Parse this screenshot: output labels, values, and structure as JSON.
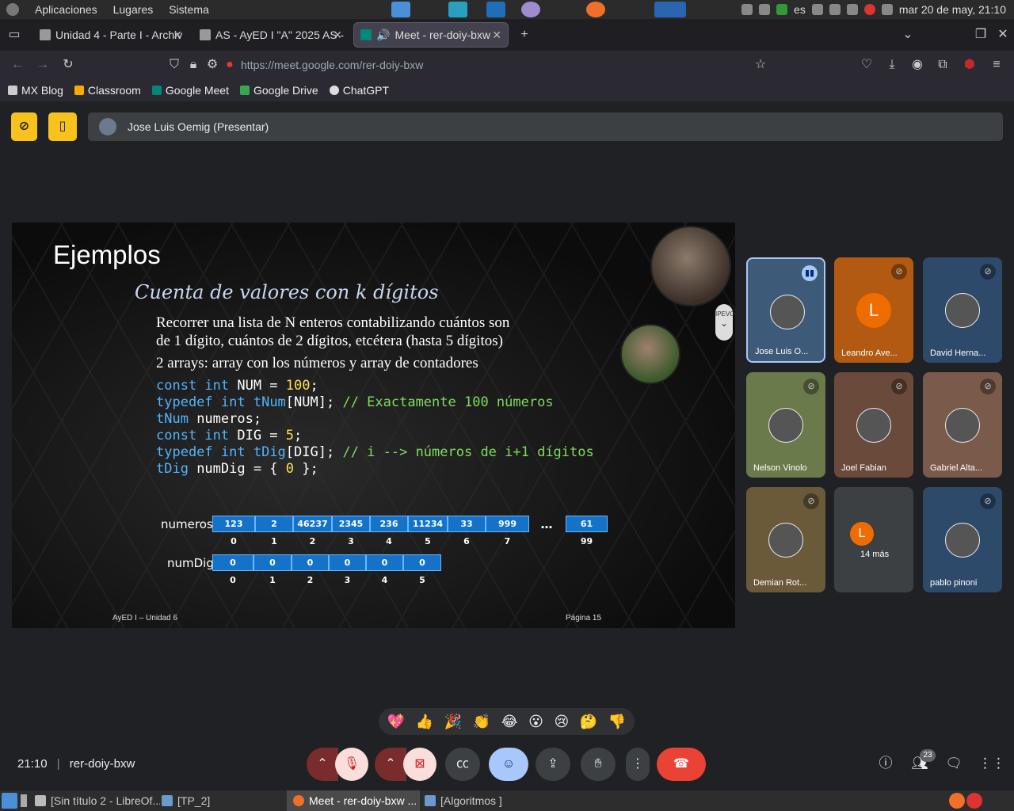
{
  "system": {
    "menu": [
      "Aplicaciones",
      "Lugares",
      "Sistema"
    ],
    "keyboard_layout": "es",
    "datetime": "mar 20 de may, 21:10"
  },
  "browser": {
    "tabs": [
      {
        "label": "Unidad 4 - Parte I - Archiv",
        "active": false
      },
      {
        "label": "AS - AyED I \"A\" 2025 AS -",
        "active": false
      },
      {
        "label": "Meet - rer-doiy-bxw",
        "active": true
      }
    ],
    "url": "https://meet.google.com/rer-doiy-bxw",
    "bookmarks": [
      "MX Blog",
      "Classroom",
      "Google Meet",
      "Google Drive",
      "ChatGPT"
    ]
  },
  "meet": {
    "presenter_banner": "Jose Luis Oemig (Presentar)",
    "slide": {
      "title": "Ejemplos",
      "subtitle": "Cuenta de valores con k dígitos",
      "lines": [
        "Recorrer una lista de N enteros contabilizando cuántos son",
        "de 1 dígito, cuántos de 2 dígitos, etcétera (hasta 5 dígitos)",
        "2 arrays: array con los números y array de contadores"
      ],
      "code": [
        {
          "kw": "const int",
          "rest": " NUM = ",
          "num": "100",
          "tail": ";",
          "comment": ""
        },
        {
          "kw": "typedef int",
          "rest": " ",
          "type": "tNum",
          "tail": "[NUM]; ",
          "comment": "// Exactamente 100 números"
        },
        {
          "kw": "",
          "type": "tNum",
          "rest": " numeros;",
          "num": "",
          "tail": "",
          "comment": ""
        },
        {
          "kw": "const int",
          "rest": " DIG = ",
          "num": "5",
          "tail": ";",
          "comment": ""
        },
        {
          "kw": "typedef int",
          "rest": " ",
          "type": "tDig",
          "tail": "[DIG]; ",
          "comment": "// i --> números de i+1 dígitos"
        },
        {
          "kw": "",
          "type": "tDig",
          "rest": " numDig = { ",
          "num": "0",
          "tail": " };",
          "comment": ""
        }
      ],
      "array_numeros": {
        "label": "numeros",
        "values": [
          "123",
          "2",
          "46237",
          "2345",
          "236",
          "11234",
          "33",
          "999"
        ],
        "indices": [
          "0",
          "1",
          "2",
          "3",
          "4",
          "5",
          "6",
          "7"
        ],
        "ellipsis": "…",
        "last_value": "61",
        "last_index": "99"
      },
      "array_numdig": {
        "label": "numDig",
        "values": [
          "0",
          "0",
          "0",
          "0",
          "0",
          "0"
        ],
        "indices": [
          "0",
          "1",
          "2",
          "3",
          "4",
          "5"
        ]
      },
      "footer_left": "AyED I – Unidad 6",
      "footer_right": "Página 15",
      "pip_label": "IPEVO"
    },
    "participants": [
      {
        "name": "Jose Luis O...",
        "speaking": true,
        "letter": ""
      },
      {
        "name": "Leandro Ave...",
        "speaking": false,
        "letter": "L"
      },
      {
        "name": "David Herna...",
        "speaking": false,
        "letter": ""
      },
      {
        "name": "Nelson Vinolo",
        "speaking": false,
        "letter": ""
      },
      {
        "name": "Joel Fabian",
        "speaking": false,
        "letter": ""
      },
      {
        "name": "Gabriel Alta...",
        "speaking": false,
        "letter": ""
      },
      {
        "name": "Demian Rot...",
        "speaking": false,
        "letter": ""
      },
      {
        "name": "14 más",
        "speaking": false,
        "letter": "L"
      },
      {
        "name": "pablo pinoni",
        "speaking": false,
        "letter": ""
      }
    ],
    "reactions": [
      "💖",
      "👍",
      "🎉",
      "👏",
      "😂",
      "😮",
      "😢",
      "🤔",
      "👎"
    ],
    "time": "21:10",
    "meeting_code": "rer-doiy-bxw",
    "participant_count": "23"
  },
  "taskbar": [
    {
      "label": "[Sin título 2 - LibreOf...",
      "active": false
    },
    {
      "label": "[TP_2]",
      "active": false
    },
    {
      "label": "Meet - rer-doiy-bxw ...",
      "active": true
    },
    {
      "label": "[Algoritmos ]",
      "active": false
    }
  ],
  "colors": {
    "meet_bg": "#202124",
    "accent_yellow": "#f7c21b",
    "hangup_red": "#ea4335",
    "array_blue": "#1473c9"
  }
}
